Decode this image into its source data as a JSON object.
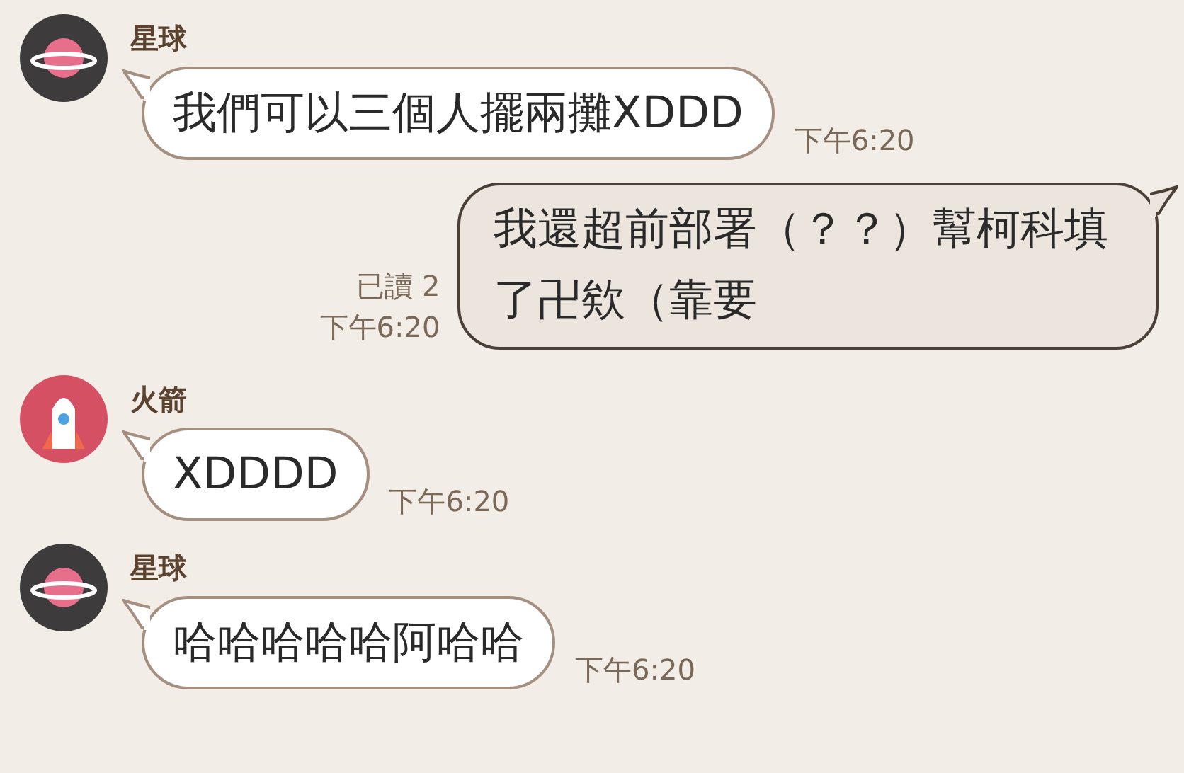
{
  "messages": [
    {
      "kind": "incoming",
      "sender": "星球",
      "avatar": {
        "kind": "planet"
      },
      "text": "我們可以三個人擺兩攤XDDD",
      "time": "下午6:20"
    },
    {
      "kind": "outgoing",
      "read": "已讀 2",
      "text": "我還超前部署（？？）幫柯科填了卍欸（靠要",
      "time": "下午6:20"
    },
    {
      "kind": "incoming",
      "sender": "火箭",
      "avatar": {
        "kind": "rocket"
      },
      "text": "XDDDD",
      "time": "下午6:20"
    },
    {
      "kind": "incoming",
      "sender": "星球",
      "avatar": {
        "kind": "planet"
      },
      "text": "哈哈哈哈哈阿哈哈",
      "time": "下午6:20"
    }
  ]
}
